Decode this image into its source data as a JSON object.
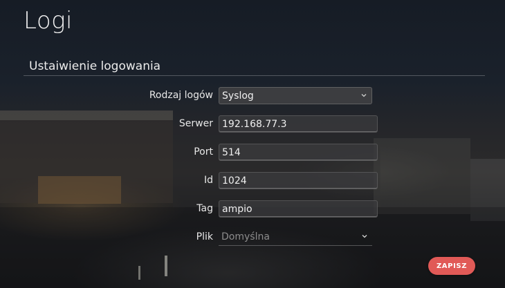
{
  "page": {
    "title": "Logi"
  },
  "section": {
    "title": "Ustaiwienie logowania"
  },
  "form": {
    "log_type": {
      "label": "Rodzaj logów",
      "value": "Syslog",
      "icon": "chevron-down-icon"
    },
    "server": {
      "label": "Serwer",
      "value": "192.168.77.3"
    },
    "port": {
      "label": "Port",
      "value": "514"
    },
    "id": {
      "label": "Id",
      "value": "1024"
    },
    "tag": {
      "label": "Tag",
      "value": "ampio"
    },
    "file": {
      "label": "Plik",
      "value": "Domyślna",
      "icon": "chevron-down-icon",
      "disabled": true
    }
  },
  "actions": {
    "save_label": "ZAPISZ",
    "save_color": "#e15a57"
  }
}
